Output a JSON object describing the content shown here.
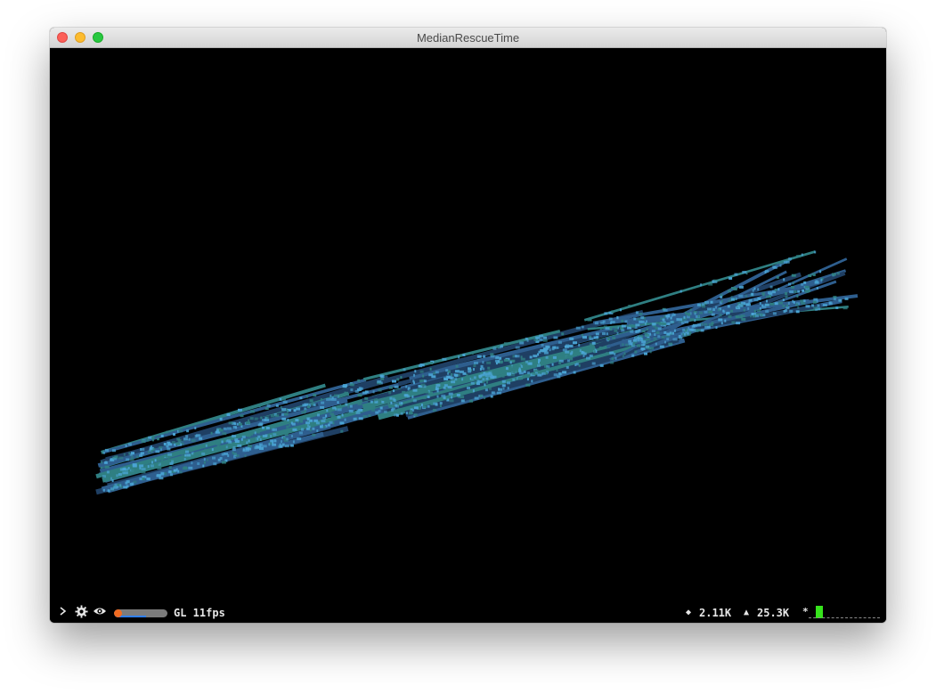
{
  "window": {
    "title": "MedianRescueTime"
  },
  "statusbar": {
    "renderer": "GL 11fps",
    "vertices": "2.11K",
    "triangles": "25.3K",
    "progress_fraction": 0.6,
    "command_value": ""
  },
  "icons": {
    "close": "close-window-icon",
    "minimize": "minimize-window-icon",
    "zoom": "zoom-window-icon",
    "prompt": "chevron-right-icon",
    "settings": "gear-icon",
    "view": "eye-icon",
    "vertices": "diamond-icon",
    "triangles": "triangle-icon",
    "cursor": "asterisk-icon"
  },
  "colors": {
    "background": "#000000",
    "strip_main": "#2e5e8e",
    "strip_light": "#4aa4d4",
    "strip_dark": "#1f3f63",
    "strip_teal": "#2f7f82",
    "progress_track": "#7c7c7c",
    "progress_fill": "#2f7ff7",
    "progress_dot": "#f26b20",
    "caret": "#36e31c"
  }
}
